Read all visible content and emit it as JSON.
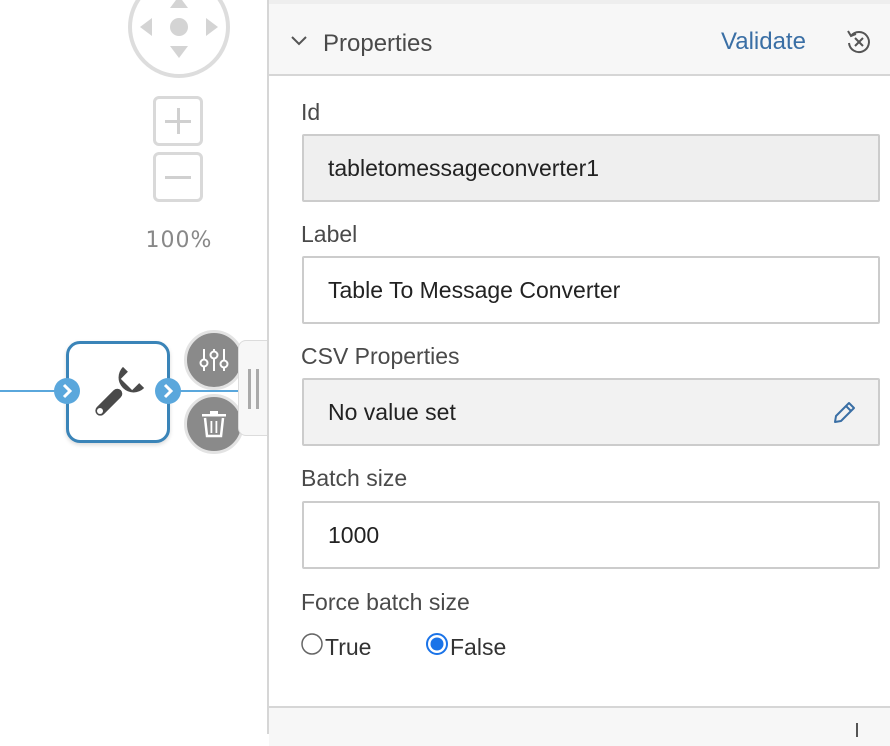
{
  "canvas": {
    "zoom_level": "100%",
    "node": {
      "type_icon": "wrench-icon"
    },
    "node_actions": [
      "sliders-icon",
      "trash-icon"
    ]
  },
  "properties_panel": {
    "title": "Properties",
    "validate_label": "Validate",
    "fields": {
      "id": {
        "label": "Id",
        "value": "tabletomessageconverter1"
      },
      "label": {
        "label": "Label",
        "value": "Table To Message Converter"
      },
      "csv_properties": {
        "label": "CSV Properties",
        "value": "No value set"
      },
      "batch_size": {
        "label": "Batch size",
        "value": "1000"
      },
      "force_batch_size": {
        "label": "Force batch size",
        "options": [
          {
            "label": "True",
            "selected": false
          },
          {
            "label": "False",
            "selected": true
          }
        ]
      }
    }
  },
  "colors": {
    "accent": "#3a6fa5",
    "node_border": "#3a84b8",
    "port": "#5aa7dc",
    "radio_selected": "#1a73e8"
  }
}
